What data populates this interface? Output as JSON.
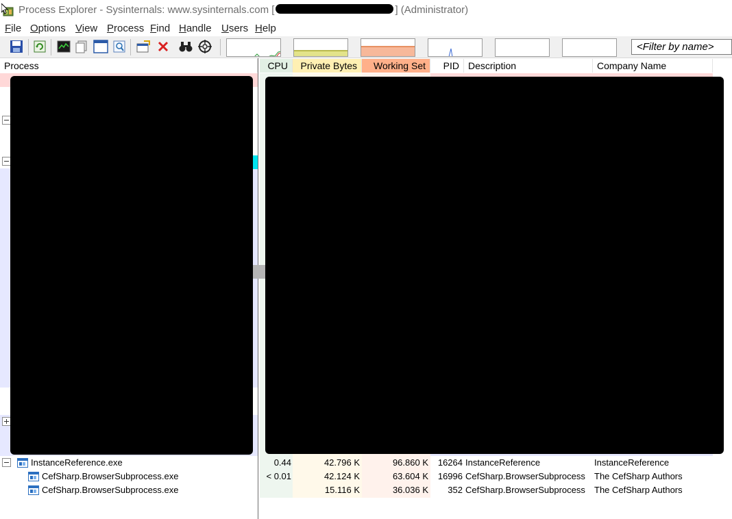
{
  "window": {
    "title_prefix": "Process Explorer - Sysinternals: www.sysinternals.com [",
    "title_suffix": "] (Administrator)"
  },
  "menu": [
    {
      "label": "File",
      "key": "F",
      "rest": "ile"
    },
    {
      "label": "Options",
      "key": "O",
      "rest": "ptions"
    },
    {
      "label": "View",
      "key": "V",
      "rest": "iew"
    },
    {
      "label": "Process",
      "key": "P",
      "rest": "rocess"
    },
    {
      "label": "Find",
      "key": "F",
      "rest": "ind"
    },
    {
      "label": "Handle",
      "key": "H",
      "rest": "andle"
    },
    {
      "label": "Users",
      "key": "U",
      "rest": "sers"
    },
    {
      "label": "Help",
      "key": "H",
      "rest": "elp"
    }
  ],
  "toolbar": {
    "buttons": [
      "save-icon",
      "refresh-icon",
      "system-info-icon",
      "properties-icon",
      "window-icon",
      "find-handle-icon",
      "options-icon",
      "kill-process-icon",
      "binoculars-icon",
      "target-crosshair-icon"
    ],
    "filter_placeholder": "<Filter by name>",
    "graph_colors": {
      "cpu": "#2e9b3a",
      "commit": "#c8c84a",
      "physical": "#f09a6a",
      "io": "#3a6ad6"
    }
  },
  "columns": {
    "process": "Process",
    "cpu": "CPU",
    "private_bytes": "Private Bytes",
    "working_set": "Working Set",
    "pid": "PID",
    "description": "Description",
    "company": "Company Name"
  },
  "colors": {
    "cpu_header": "#e2f0e4",
    "private_header": "#fff0b3",
    "working_header": "#ffb08a",
    "service_row": "#ffd8d8",
    "own_process_row": "#e6e8ff",
    "highlight": "#00e5f0"
  },
  "processes": [
    {
      "name": "InstanceReference.exe",
      "cpu": "0.44",
      "private": "42.796 K",
      "working": "96.860 K",
      "pid": "16264",
      "description": "InstanceReference",
      "company": "InstanceReference"
    },
    {
      "name": "CefSharp.BrowserSubprocess.exe",
      "cpu": "< 0.01",
      "private": "42.124 K",
      "working": "63.604 K",
      "pid": "16996",
      "description": "CefSharp.BrowserSubprocess",
      "company": "The CefSharp Authors"
    },
    {
      "name": "CefSharp.BrowserSubprocess.exe",
      "cpu": "",
      "private": "15.116 K",
      "working": "36.036 K",
      "pid": "352",
      "description": "CefSharp.BrowserSubprocess",
      "company": "The CefSharp Authors"
    }
  ]
}
